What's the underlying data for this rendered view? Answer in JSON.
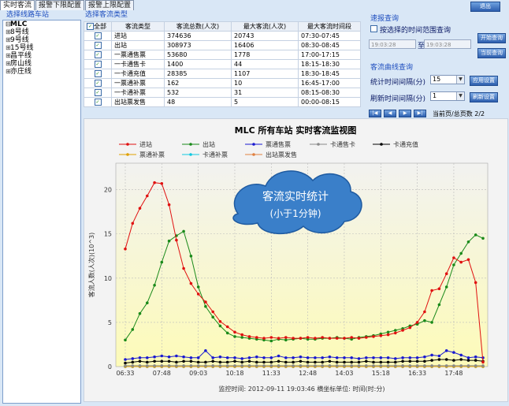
{
  "tabs": [
    {
      "label": "实时客流",
      "active": true
    },
    {
      "label": "报警下限配置",
      "active": false
    },
    {
      "label": "报警上限配置",
      "active": false
    }
  ],
  "exit_label": "退出",
  "left_panel": {
    "title": "选择线路车站",
    "root": "MLC",
    "lines": [
      "8号线",
      "9号线",
      "15号线",
      "昌平线",
      "房山线",
      "亦庄线"
    ]
  },
  "flow_panel": {
    "title": "选择客流类型",
    "columns": [
      "全部",
      "客流类型",
      "客流总数(人次)",
      "最大客流(人次)",
      "最大客流时间段"
    ],
    "rows": [
      [
        "进站",
        "374636",
        "20743",
        "07:30-07:45"
      ],
      [
        "出站",
        "308973",
        "16406",
        "08:30-08:45"
      ],
      [
        "一票通售票",
        "53680",
        "1778",
        "17:00-17:15"
      ],
      [
        "一卡通售卡",
        "1400",
        "44",
        "18:15-18:30"
      ],
      [
        "一卡通充值",
        "28385",
        "1107",
        "18:30-18:45"
      ],
      [
        "一票通补票",
        "162",
        "10",
        "16:45-17:00"
      ],
      [
        "一卡通补票",
        "532",
        "31",
        "08:15-08:30"
      ],
      [
        "出站票发售",
        "48",
        "5",
        "00:00-08:15"
      ]
    ]
  },
  "report_query": {
    "title": "速报查询",
    "checkbox_label": "按选择的时间范围查询",
    "start_time": "19:03:28",
    "to_label": "至",
    "end_time": "19:03:28",
    "btn_query": "开始查询",
    "btn_current": "当前查询"
  },
  "curve_query": {
    "title": "客流曲线查询",
    "interval_label": "统计时间间隔(分)",
    "interval_value": "15",
    "refresh_label": "刷新时间间隔(分)",
    "refresh_value": "1",
    "btn_apply": "应用设置",
    "btn_refresh": "刷新设置"
  },
  "pager": {
    "buttons": [
      "|◀",
      "◀",
      "▶",
      "▶|"
    ],
    "info": "当前页/总页数  2/2"
  },
  "annotation": {
    "line1": "客流实时统计",
    "line2": "(小于1分钟)"
  },
  "chart_data": {
    "type": "line",
    "title": "MLC 所有车站  实时客流监视图",
    "ylabel": "客流人数(人次)(10^3)",
    "xlabel": "监控时间: 2012-09-11 19:03:46 横坐标单位: 时间(时:分)",
    "ylim": [
      0,
      23
    ],
    "yticks": [
      0,
      5,
      10,
      15,
      20
    ],
    "x": [
      "06:33",
      "06:48",
      "07:03",
      "07:18",
      "07:33",
      "07:48",
      "08:03",
      "08:18",
      "08:33",
      "08:48",
      "09:03",
      "09:18",
      "09:33",
      "09:48",
      "10:03",
      "10:18",
      "10:33",
      "10:48",
      "11:03",
      "11:18",
      "11:33",
      "11:48",
      "12:03",
      "12:18",
      "12:33",
      "12:48",
      "13:03",
      "13:18",
      "13:33",
      "13:48",
      "14:03",
      "14:18",
      "14:33",
      "14:48",
      "15:03",
      "15:18",
      "15:33",
      "15:48",
      "16:03",
      "16:18",
      "16:33",
      "16:48",
      "17:03",
      "17:18",
      "17:33",
      "17:48",
      "18:03",
      "18:18",
      "18:33",
      "18:48"
    ],
    "xtick_labels": [
      "06:33",
      "07:48",
      "09:03",
      "10:18",
      "11:33",
      "12:48",
      "14:03",
      "15:18",
      "16:33",
      "17:48"
    ],
    "legend_placement": "top",
    "series": [
      {
        "name": "进站",
        "color": "#e01010",
        "values": [
          13.3,
          16.2,
          17.9,
          19.3,
          20.8,
          20.7,
          18.3,
          14.3,
          11.1,
          9.4,
          8.2,
          7.3,
          6.2,
          5.1,
          4.5,
          3.9,
          3.6,
          3.4,
          3.3,
          3.2,
          3.3,
          3.2,
          3.3,
          3.2,
          3.2,
          3.3,
          3.2,
          3.3,
          3.2,
          3.2,
          3.2,
          3.3,
          3.2,
          3.3,
          3.4,
          3.5,
          3.6,
          3.8,
          4.1,
          4.4,
          5.0,
          6.2,
          8.6,
          8.8,
          10.5,
          12.3,
          11.8,
          12.1,
          9.5,
          0.5
        ]
      },
      {
        "name": "出站",
        "color": "#1a8a1a",
        "values": [
          3.0,
          4.2,
          6.0,
          7.2,
          9.2,
          11.8,
          14.2,
          14.8,
          15.3,
          12.5,
          9.0,
          6.8,
          5.6,
          4.6,
          3.8,
          3.4,
          3.3,
          3.2,
          3.1,
          3.0,
          2.9,
          3.1,
          3.0,
          3.1,
          3.2,
          3.1,
          3.1,
          3.2,
          3.2,
          3.3,
          3.2,
          3.1,
          3.3,
          3.4,
          3.5,
          3.7,
          3.9,
          4.1,
          4.3,
          4.6,
          4.8,
          5.2,
          5.0,
          7.0,
          9.0,
          11.5,
          12.8,
          14.1,
          14.9,
          14.5
        ]
      },
      {
        "name": "票通售票",
        "color": "#1a1ad0",
        "values": [
          0.8,
          0.9,
          1.0,
          1.0,
          1.1,
          1.2,
          1.1,
          1.2,
          1.1,
          1.0,
          1.0,
          1.8,
          1.0,
          1.1,
          1.0,
          1.0,
          0.9,
          1.0,
          1.1,
          1.0,
          1.0,
          1.2,
          1.0,
          1.0,
          1.1,
          1.0,
          1.0,
          1.0,
          1.1,
          1.0,
          1.0,
          1.0,
          0.9,
          1.0,
          1.0,
          1.0,
          1.0,
          0.9,
          1.0,
          1.0,
          1.0,
          1.1,
          1.3,
          1.2,
          1.8,
          1.6,
          1.3,
          1.0,
          1.1,
          1.0
        ]
      },
      {
        "name": "卡通售卡",
        "color": "#8a8a8a",
        "values": [
          0.1,
          0.1,
          0.1,
          0.1,
          0.1,
          0.1,
          0.1,
          0.1,
          0.1,
          0.1,
          0.1,
          0.1,
          0.1,
          0.1,
          0.1,
          0.1,
          0.1,
          0.1,
          0.1,
          0.1,
          0.1,
          0.1,
          0.1,
          0.1,
          0.1,
          0.1,
          0.1,
          0.1,
          0.1,
          0.1,
          0.1,
          0.1,
          0.1,
          0.1,
          0.1,
          0.1,
          0.1,
          0.1,
          0.1,
          0.1,
          0.1,
          0.1,
          0.1,
          0.1,
          0.1,
          0.1,
          0.1,
          0.1,
          0.1,
          0.1
        ]
      },
      {
        "name": "卡通充值",
        "color": "#000000",
        "values": [
          0.4,
          0.5,
          0.6,
          0.5,
          0.6,
          0.6,
          0.6,
          0.5,
          0.6,
          0.6,
          0.5,
          0.5,
          0.6,
          0.5,
          0.5,
          0.6,
          0.5,
          0.6,
          0.5,
          0.5,
          0.5,
          0.6,
          0.5,
          0.5,
          0.6,
          0.5,
          0.5,
          0.5,
          0.6,
          0.5,
          0.5,
          0.5,
          0.5,
          0.6,
          0.5,
          0.5,
          0.5,
          0.5,
          0.6,
          0.6,
          0.6,
          0.6,
          0.7,
          0.8,
          0.8,
          0.7,
          0.8,
          0.7,
          0.7,
          0.6
        ]
      },
      {
        "name": "票通补票",
        "color": "#e0a000",
        "values": [
          0,
          0,
          0,
          0,
          0,
          0,
          0,
          0,
          0,
          0,
          0,
          0,
          0,
          0,
          0,
          0,
          0,
          0,
          0,
          0,
          0,
          0,
          0,
          0,
          0,
          0,
          0,
          0,
          0,
          0,
          0,
          0,
          0,
          0,
          0,
          0,
          0,
          0,
          0,
          0,
          0,
          0,
          0,
          0,
          0,
          0,
          0,
          0,
          0,
          0
        ]
      },
      {
        "name": "卡通补票",
        "color": "#10c8e0",
        "values": [
          0,
          0,
          0,
          0,
          0,
          0,
          0,
          0,
          0,
          0,
          0,
          0,
          0,
          0,
          0,
          0,
          0,
          0,
          0,
          0,
          0,
          0,
          0,
          0,
          0,
          0,
          0,
          0,
          0,
          0,
          0,
          0,
          0,
          0,
          0,
          0,
          0,
          0,
          0,
          0,
          0,
          0,
          0,
          0,
          0,
          0,
          0,
          0,
          0,
          0
        ]
      },
      {
        "name": "出站票发售",
        "color": "#e08040",
        "values": [
          0,
          0,
          0,
          0,
          0,
          0,
          0,
          0,
          0,
          0,
          0,
          0,
          0,
          0,
          0,
          0,
          0,
          0,
          0,
          0,
          0,
          0,
          0,
          0,
          0,
          0,
          0,
          0,
          0,
          0,
          0,
          0,
          0,
          0,
          0,
          0,
          0,
          0,
          0,
          0,
          0,
          0,
          0,
          0,
          0,
          0,
          0,
          0,
          0,
          0
        ]
      }
    ]
  }
}
